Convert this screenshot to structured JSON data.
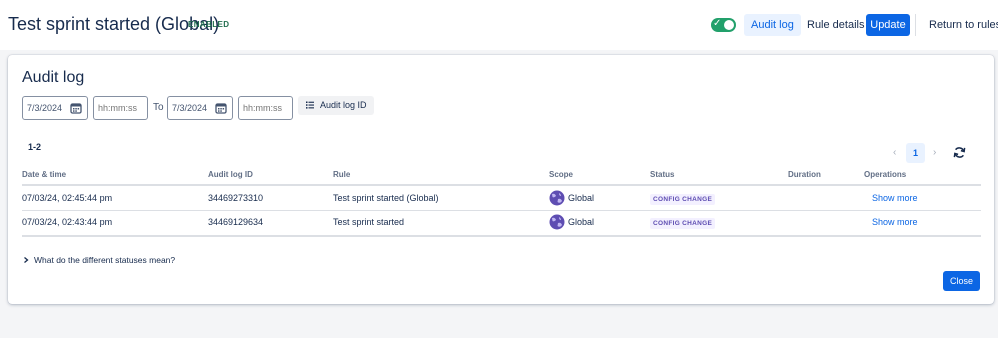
{
  "header": {
    "title": "Test sprint started (Global)",
    "badge": "ENABLED",
    "toggle_icon": "check-icon",
    "buttons": {
      "audit_log": "Audit log",
      "rule_details": "Rule details",
      "update": "Update",
      "return": "Return to rules"
    }
  },
  "modal": {
    "title": "Audit log",
    "filters": {
      "from_date": "7/3/2024",
      "from_time_placeholder": "hh:mm:ss",
      "to_label": "To",
      "to_date": "7/3/2024",
      "to_time_placeholder": "hh:mm:ss",
      "audit_id_button": "Audit log ID"
    },
    "count": "1-2",
    "pagination": {
      "current": "1"
    },
    "table": {
      "columns": [
        "Date & time",
        "Audit log ID",
        "Rule",
        "Scope",
        "Status",
        "Duration",
        "Operations"
      ],
      "rows": [
        {
          "datetime": "07/03/24, 02:45:44 pm",
          "id": "34469273310",
          "rule": "Test sprint started (Global)",
          "scope": "Global",
          "status": "CONFIG CHANGE",
          "duration": "",
          "operation": "Show more"
        },
        {
          "datetime": "07/03/24, 02:43:44 pm",
          "id": "34469129634",
          "rule": "Test sprint started",
          "scope": "Global",
          "status": "CONFIG CHANGE",
          "duration": "",
          "operation": "Show more"
        }
      ]
    },
    "faq": "What do the different statuses mean?",
    "close": "Close"
  },
  "colors": {
    "primary": "#0c66e4",
    "toggle_on": "#22a06b",
    "status_bg": "#f3f0ff",
    "status_text": "#5e4db2",
    "badge_text": "#216e4e"
  }
}
